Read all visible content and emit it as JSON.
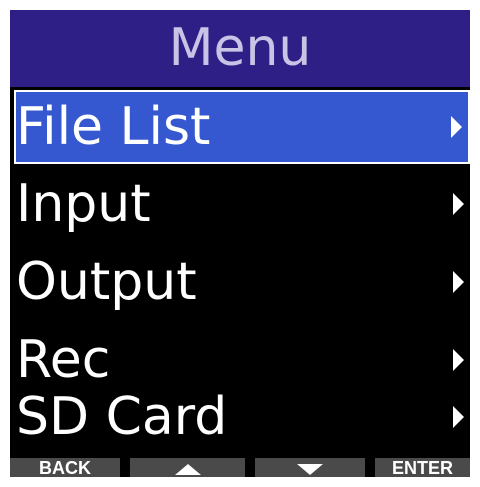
{
  "title": "Menu",
  "menu": {
    "items": [
      {
        "label": "File List",
        "selected": true
      },
      {
        "label": "Input",
        "selected": false
      },
      {
        "label": "Output",
        "selected": false
      },
      {
        "label": "Rec",
        "selected": false
      },
      {
        "label": "SD Card",
        "selected": false
      }
    ]
  },
  "softkeys": {
    "back": "BACK",
    "up_icon": "arrow-up-icon",
    "down_icon": "arrow-down-icon",
    "enter": "ENTER"
  },
  "colors": {
    "title_bar": "#2e1f86",
    "title_text": "#c9c3e6",
    "selection": "#3557cf",
    "background": "#000000",
    "softkey_bg": "#4a4a4a"
  }
}
